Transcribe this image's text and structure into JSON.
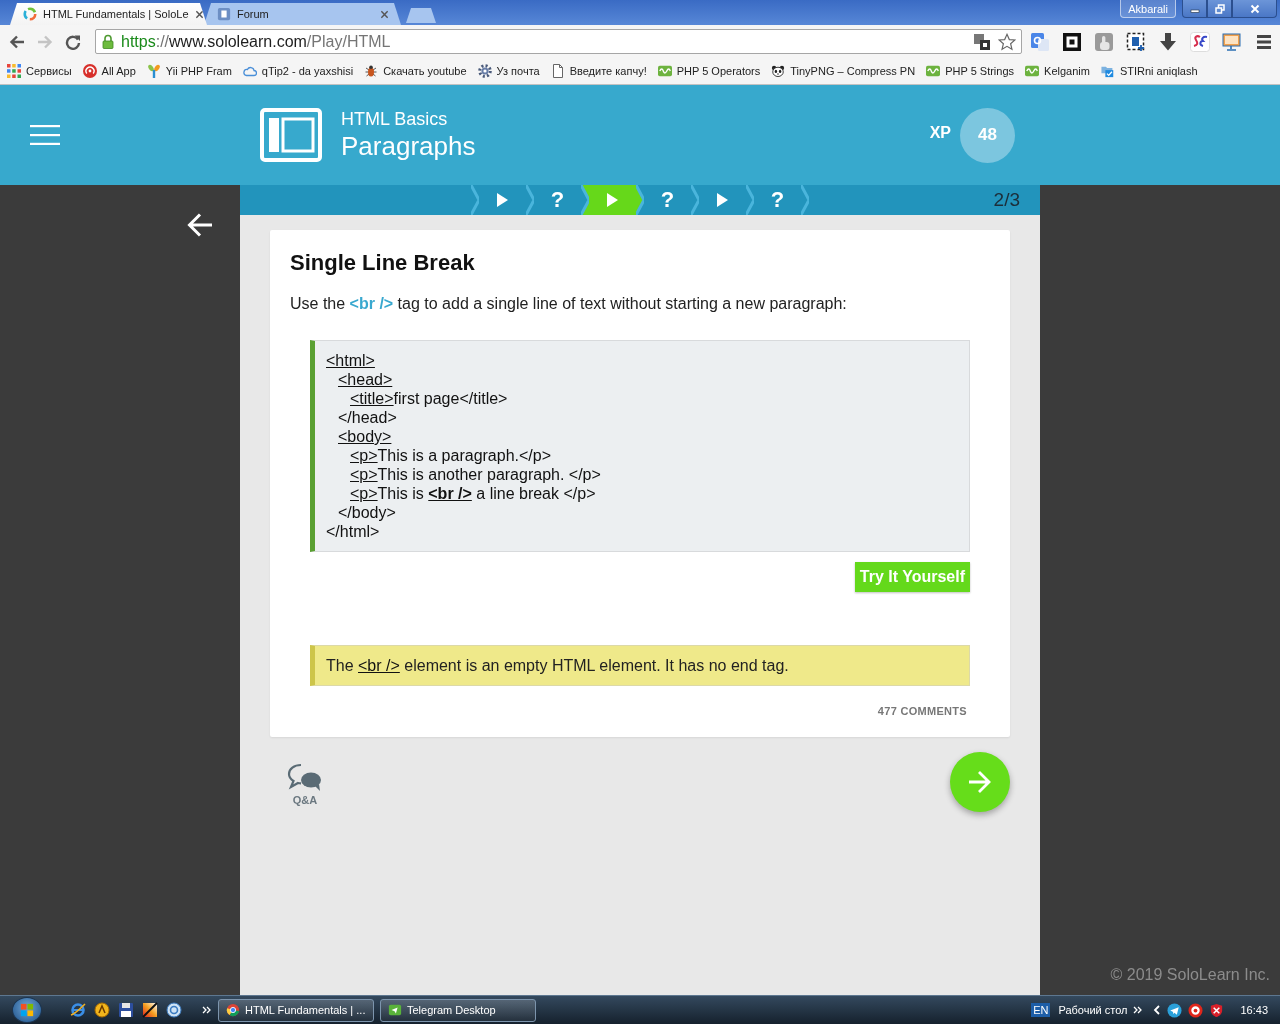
{
  "browser": {
    "tabs": [
      {
        "title": "HTML Fundamentals | SoloLe",
        "selected": true
      },
      {
        "title": "Forum",
        "selected": false
      }
    ],
    "profile": "Akbarali",
    "forward_disabled": true,
    "url": {
      "scheme": "https",
      "separator": "://",
      "host": "www.sololearn.com",
      "path": "/Play/HTML"
    },
    "bookmarks": [
      {
        "label": "Сервисы",
        "kind": "apps"
      },
      {
        "label": "All App",
        "kind": "badge"
      },
      {
        "label": "Yii PHP Fram",
        "kind": "sprout"
      },
      {
        "label": "qTip2 - da yaxshisi",
        "kind": "cloud"
      },
      {
        "label": "Скачать youtube",
        "kind": "bug"
      },
      {
        "label": "Уз почта",
        "kind": "gear"
      },
      {
        "label": "Введите капчу!",
        "kind": "page"
      },
      {
        "label": "PHP 5 Operators",
        "kind": "w3"
      },
      {
        "label": "TinyPNG – Compress PN",
        "kind": "panda"
      },
      {
        "label": "PHP 5 Strings",
        "kind": "w3"
      },
      {
        "label": "Kelganim",
        "kind": "w3"
      },
      {
        "label": "STIRni aniqlash",
        "kind": "folder"
      }
    ]
  },
  "header": {
    "course": "HTML Basics",
    "lesson": "Paragraphs",
    "xp_label": "XP",
    "xp": "48"
  },
  "progress": {
    "steps": [
      {
        "kind": "lesson",
        "selected": false
      },
      {
        "kind": "quiz",
        "label": "?",
        "selected": false
      },
      {
        "kind": "lesson",
        "selected": true
      },
      {
        "kind": "quiz",
        "label": "?",
        "selected": false
      },
      {
        "kind": "lesson",
        "selected": false
      },
      {
        "kind": "quiz",
        "label": "?",
        "selected": false
      }
    ],
    "counter": "2/3"
  },
  "card": {
    "title": "Single Line Break",
    "intro": "Use the **<br />** tag to add a single line of text without starting a new paragraph:",
    "code": [
      {
        "segments": [
          {
            "text": "<html>",
            "link": true
          }
        ],
        "children": [
          {
            "segments": [
              {
                "text": "<head>",
                "link": true
              }
            ],
            "children": [
              {
                "segments": [
                  {
                    "text": "<title>",
                    "link": true
                  },
                  {
                    "text": "first page</title>",
                    "link": false
                  }
                ]
              }
            ]
          },
          {
            "segments": [
              {
                "text": "</head>",
                "link": false
              }
            ]
          },
          {
            "segments": [
              {
                "text": "<body>",
                "link": true
              }
            ],
            "children": [
              {
                "segments": [
                  {
                    "text": "<p>",
                    "link": true
                  },
                  {
                    "text": "This is a paragraph.</p>",
                    "link": false
                  }
                ]
              },
              {
                "segments": [
                  {
                    "text": "<p>",
                    "link": true
                  },
                  {
                    "text": "This is another paragraph. </p>",
                    "link": false
                  }
                ]
              },
              {
                "segments": [
                  {
                    "text": "<p>",
                    "link": true
                  },
                  {
                    "text": "This is ",
                    "link": false
                  },
                  {
                    "text": "**<br />**",
                    "link": true
                  },
                  {
                    "text": " a line break </p>",
                    "link": false
                  }
                ]
              }
            ]
          },
          {
            "segments": [
              {
                "text": "</body>",
                "link": false
              }
            ]
          }
        ]
      },
      {
        "segments": [
          {
            "text": "</html>",
            "link": false
          }
        ]
      }
    ],
    "try_button": "Try It Yourself",
    "note": [
      {
        "text": "The ",
        "link": false
      },
      {
        "text": "<br />",
        "link": true
      },
      {
        "text": " element is an empty HTML element. It has no end tag.",
        "link": false
      }
    ],
    "comments": "477 COMMENTS"
  },
  "qa_label": "Q&A",
  "footer": "© 2019 SoloLearn Inc.",
  "taskbar": {
    "windows": [
      {
        "title": "HTML Fundamentals | ..."
      },
      {
        "title": "Telegram Desktop"
      }
    ],
    "language": "EN",
    "desktop": "Рабочий стол",
    "time": "16:43"
  }
}
